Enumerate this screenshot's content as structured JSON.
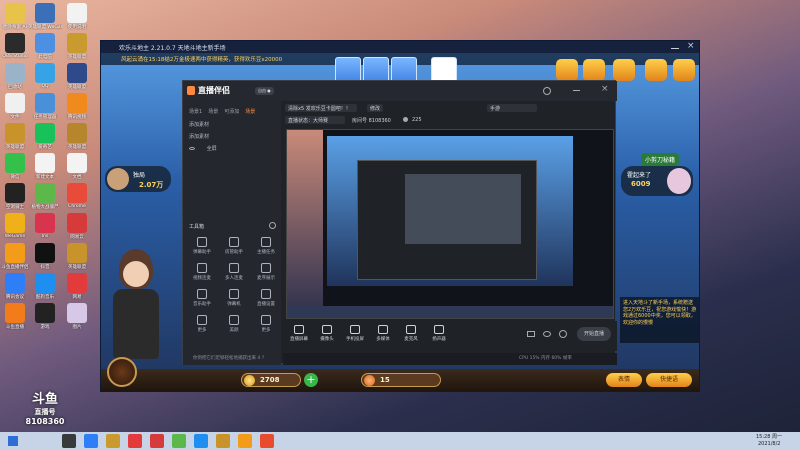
{
  "desktop": {
    "icons": [
      {
        "label": "圈外探索 Ai",
        "color": "#e8c34a"
      },
      {
        "label": "英雄联盟 WeGame版",
        "color": "#3b6fb8"
      },
      {
        "label": "使用说明",
        "color": "#f2f2f2"
      },
      {
        "label": "OBS Studio",
        "color": "#2b2b2b"
      },
      {
        "label": "此电脑",
        "color": "#4d8fe0"
      },
      {
        "label": "英雄联盟",
        "color": "#c99a2e"
      },
      {
        "label": "回收站",
        "color": "#9ab3c8"
      },
      {
        "label": "QQ",
        "color": "#35a3e6"
      },
      {
        "label": "英雄联盟",
        "color": "#2f4a8a"
      },
      {
        "label": "文件",
        "color": "#f0f0f0"
      },
      {
        "label": "任务管理器",
        "color": "#4a90d9"
      },
      {
        "label": "腾讯视频",
        "color": "#f08a1c"
      },
      {
        "label": "英雄联盟",
        "color": "#c7932a"
      },
      {
        "label": "爱奇艺",
        "color": "#19c15a"
      },
      {
        "label": "英雄联盟",
        "color": "#b6862c"
      },
      {
        "label": "微信",
        "color": "#33c14b"
      },
      {
        "label": "新建文本",
        "color": "#f3f3f3"
      },
      {
        "label": "文档",
        "color": "#f3f3f3"
      },
      {
        "label": "空洞骑士",
        "color": "#222"
      },
      {
        "label": "植物大战僵尸",
        "color": "#5cb84a"
      },
      {
        "label": "Chrome",
        "color": "#e84b3a"
      },
      {
        "label": "WeGame",
        "color": "#f0b01a"
      },
      {
        "label": "Ins",
        "color": "#d9344e"
      },
      {
        "label": "网易云",
        "color": "#d73a3a"
      },
      {
        "label": "斗鱼直播伴侣",
        "color": "#f39c1a"
      },
      {
        "label": "抖音",
        "color": "#111"
      },
      {
        "label": "英雄联盟",
        "color": "#c7932a"
      },
      {
        "label": "腾讯会议",
        "color": "#2d7ef7"
      },
      {
        "label": "酷狗音乐",
        "color": "#1e8ff0"
      },
      {
        "label": "网易",
        "color": "#e33b3b"
      },
      {
        "label": "斗鱼直播",
        "color": "#f27c1a"
      },
      {
        "label": "游戏",
        "color": "#222"
      },
      {
        "label": "图片",
        "color": "#d8c8e8"
      }
    ],
    "watermark": {
      "brand": "斗鱼",
      "sub": "直播号",
      "room": "8108360"
    }
  },
  "taskbar": {
    "time": "15:28 周一",
    "date": "2021/8/2",
    "apps": [
      "#3a3a3a",
      "#2d7ef7",
      "#c99a2e",
      "#e33b3b",
      "#d73a3a",
      "#5cb84a",
      "#1e8ff0",
      "#c7932a",
      "#f39c1a",
      "#e94b2e"
    ]
  },
  "game": {
    "title": "欢乐斗地主 2.21.0.7 天地斗地主新手场",
    "banner": "风起云涌在15:18结2万金极速两中获得精英，获得欢乐豆x20000",
    "left_player": {
      "name": "独局",
      "beans": "2.07万"
    },
    "right_player": {
      "name": "霍起来了",
      "beans": "6009",
      "tag": "小剪刀秘籍"
    },
    "bottom": {
      "beans": "2708",
      "diamonds": "15",
      "btn_left": "表情",
      "btn_right": "快捷语"
    },
    "chat": "进入天地斗了新手场，系统赠送您2万欢乐豆，祝您游戏愉快！游戏通过6000中奖，您可以领取，欢迎你的慢慢"
  },
  "app": {
    "logo": "直播伴侣",
    "logo_badge": "自由 ●",
    "tabs": [
      {
        "label": "场景1",
        "active": false
      },
      {
        "label": "场景",
        "active": false
      },
      {
        "label": "可添加",
        "active": false
      },
      {
        "label": "场景",
        "active": true
      }
    ],
    "scene_rows": [
      "添加素材",
      "添加素材",
      "全屏"
    ],
    "tool_header": "工具箱",
    "tools": [
      {
        "label": "弹幕助手"
      },
      {
        "label": "房管助手"
      },
      {
        "label": "主播任务"
      },
      {
        "label": "视频连麦"
      },
      {
        "label": "多人连麦"
      },
      {
        "label": "麦序展示"
      },
      {
        "label": "音乐助手"
      },
      {
        "label": "弹幕机"
      },
      {
        "label": "直播设置"
      },
      {
        "label": "更多"
      },
      {
        "label": "美颜"
      },
      {
        "label": "更多"
      }
    ],
    "stream_title": "清除x5 发欢乐豆卡圆吧！！",
    "title_tag": "修改",
    "category": "手游",
    "sub_fields": [
      "直播状态：大师赛",
      "房间号 8108360"
    ],
    "fans": "225",
    "controls": [
      {
        "label": "直播屏幕"
      },
      {
        "label": "摄像头"
      },
      {
        "label": "手机投屏"
      },
      {
        "label": "多媒体"
      },
      {
        "label": "麦克风"
      },
      {
        "label": "扬声器"
      }
    ],
    "start_button": "开始直播",
    "status": {
      "left": "你到把它们足够轻松地捕获出来 4 ?",
      "right": "CPU 15% 内存 60% 帧率"
    }
  }
}
